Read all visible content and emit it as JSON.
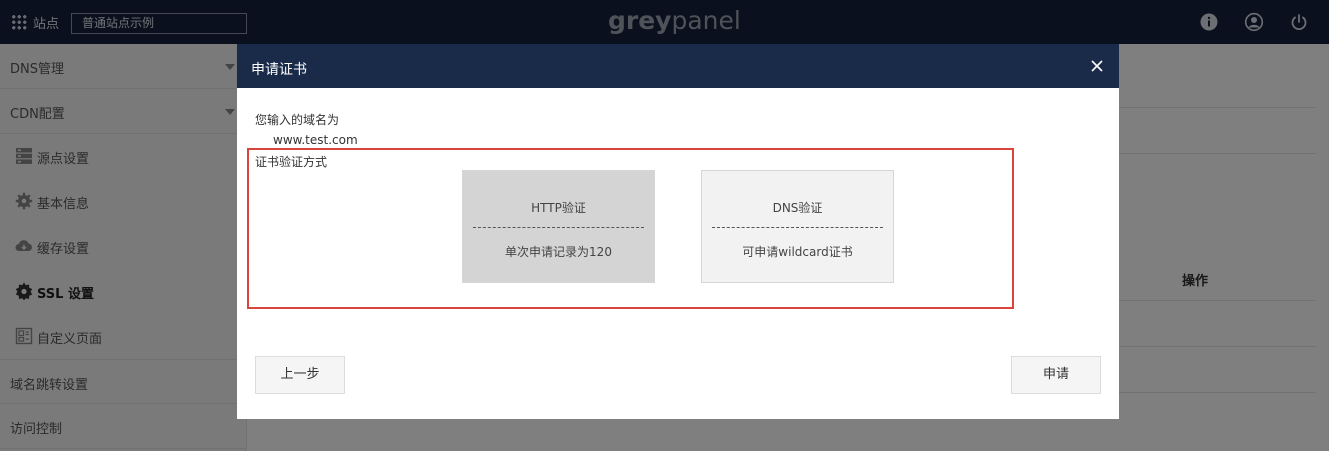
{
  "topbar": {
    "site_label": "站点",
    "site_select_value": "普通站点示例",
    "logo_grey": "grey",
    "logo_panel": "panel"
  },
  "sidebar": {
    "items": [
      {
        "label": "DNS管理"
      },
      {
        "label": "CDN配置"
      },
      {
        "label": "源点设置",
        "icon": "server-icon"
      },
      {
        "label": "基本信息",
        "icon": "gear-icon"
      },
      {
        "label": "缓存设置",
        "icon": "cloud-icon"
      },
      {
        "label": "SSL 设置",
        "icon": "badge-gear-icon",
        "active": true
      },
      {
        "label": "自定义页面",
        "icon": "page-layout-icon"
      },
      {
        "label": "域名跳转设置"
      },
      {
        "label": "访问控制"
      }
    ]
  },
  "background": {
    "column_operation": "操作"
  },
  "modal": {
    "title": "申请证书",
    "domain_label": "您输入的域名为",
    "domain_value": "www.test.com",
    "method_label": "证书验证方式",
    "methods": [
      {
        "title": "HTTP验证",
        "desc": "单次申请记录为120",
        "selected": true
      },
      {
        "title": "DNS验证",
        "desc": "可申请wildcard证书",
        "selected": false
      }
    ],
    "prev_button": "上一步",
    "apply_button": "申请"
  },
  "colors": {
    "topbar_bg": "#15213a",
    "modal_header_bg": "#1a2a49",
    "highlight_border": "#d9453c"
  }
}
